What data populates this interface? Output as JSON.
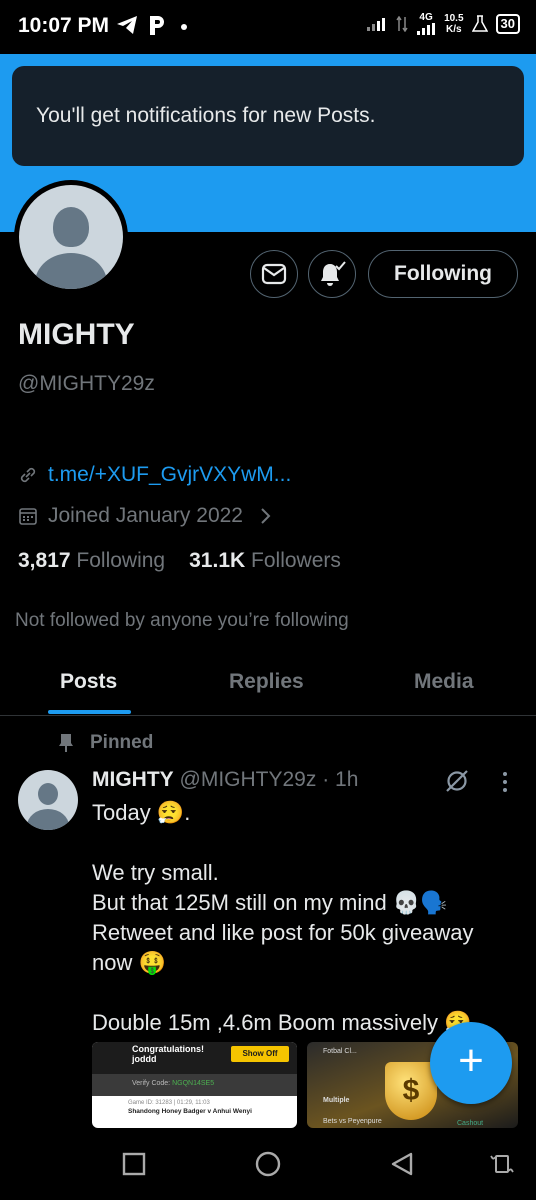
{
  "status_bar": {
    "time": "10:07 PM",
    "network_speed": "10.5",
    "network_unit": "K/s",
    "network_type": "4G",
    "battery": "30"
  },
  "toast": {
    "message": "You'll get notifications for new Posts."
  },
  "profile": {
    "name": "MIGHTY",
    "handle": "@MIGHTY29z",
    "link": "t.me/+XUF_GvjrVXYwM...",
    "joined": "Joined January 2022",
    "following_count": "3,817",
    "following_label": "Following",
    "followers_count": "31.1K",
    "followers_label": "Followers",
    "not_followed": "Not followed by anyone you’re following",
    "follow_button": "Following"
  },
  "tabs": [
    {
      "label": "Posts",
      "active": true
    },
    {
      "label": "Replies",
      "active": false
    },
    {
      "label": "Media",
      "active": false
    }
  ],
  "post": {
    "pinned_label": "Pinned",
    "author": "MIGHTY",
    "meta": "@MIGHTY29z · 1h",
    "lines": [
      "Today 😮‍💨.",
      "We try small.",
      "But that 125M still on my mind 💀🗣️",
      "Retweet and like post for 50k giveaway",
      "now 🤑",
      "Double 15m ,4.6m Boom massively 😮‍💨"
    ],
    "media1": {
      "congrats": "Congratulations!",
      "user": "joddd",
      "show_off": "Show Off",
      "verify_label": "Verify Code:",
      "verify_code": "NGQN14SE5",
      "game": "Game ID: 31283 | 01:29, 11:03",
      "teams": "Shandong Honey Badger v Anhui Wenyi"
    },
    "media2": {
      "header": "Fotbal Cl...",
      "multiple": "Multiple",
      "bets": "Bets vs Peyenpure",
      "cashout": "Cashout"
    }
  },
  "colors": {
    "accent": "#1d9bf0",
    "background": "#000000",
    "muted": "#71767b",
    "text": "#e7e9ea"
  },
  "icons": [
    "telegram-icon",
    "p-icon",
    "mail-icon",
    "bell-check-icon",
    "link-icon",
    "calendar-icon",
    "chevron-right-icon",
    "pin-icon",
    "grok-icon",
    "more-icon",
    "plus-icon",
    "square-nav-icon",
    "circle-nav-icon",
    "back-nav-icon",
    "rotate-nav-icon"
  ]
}
